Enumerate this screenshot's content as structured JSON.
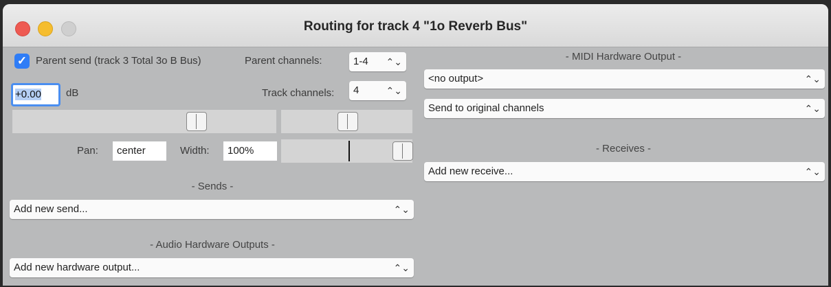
{
  "window": {
    "title": "Routing for track 4 \"1o Reverb Bus\""
  },
  "left": {
    "parent_send_checked": true,
    "parent_send_label": "Parent send (track 3 Total 3o B Bus)",
    "parent_channels_label": "Parent channels:",
    "parent_channels_value": "1-4",
    "volume_value": "+0.00",
    "volume_unit": "dB",
    "track_channels_label": "Track channels:",
    "track_channels_value": "4",
    "pan_label": "Pan:",
    "pan_value": "center",
    "width_label": "Width:",
    "width_value": "100%",
    "sends_header": "- Sends -",
    "sends_select": "Add new send...",
    "hw_outputs_header": "- Audio Hardware Outputs -",
    "hw_outputs_select": "Add new hardware output..."
  },
  "right": {
    "midi_header": "- MIDI Hardware Output -",
    "midi_output_select": "<no output>",
    "midi_channels_select": "Send to original channels",
    "receives_header": "- Receives -",
    "receives_select": "Add new receive..."
  },
  "icons": {
    "checkmark": "✓",
    "chevron": "⌃⌄"
  }
}
